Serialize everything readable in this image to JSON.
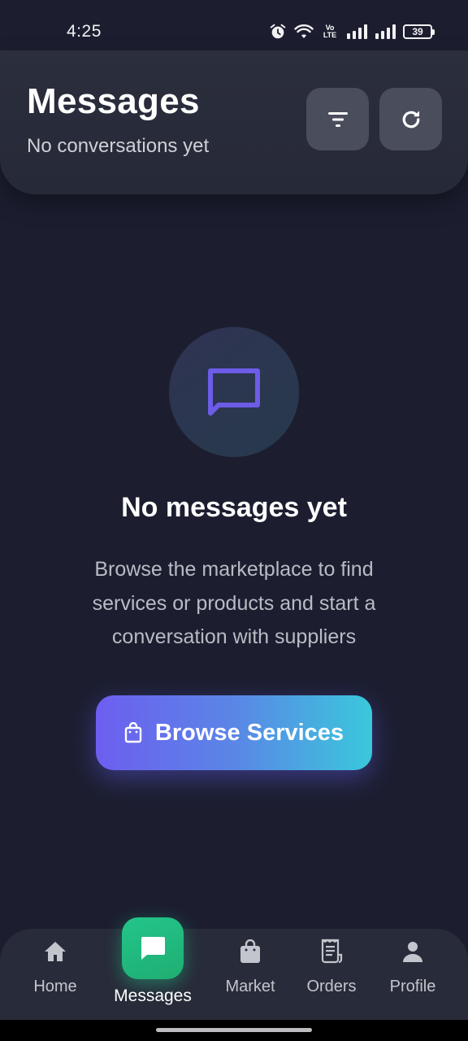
{
  "status_bar": {
    "time": "4:25",
    "volte_top": "Vo",
    "volte_bottom": "LTE",
    "battery_level": "39",
    "icons": [
      "alarm-icon",
      "wifi-icon",
      "volte-icon",
      "signal-icon",
      "signal-icon",
      "battery-icon"
    ]
  },
  "header": {
    "title": "Messages",
    "subtitle": "No conversations yet",
    "filter_icon": "filter-icon",
    "refresh_icon": "refresh-icon"
  },
  "empty_state": {
    "icon": "chat-bubble-icon",
    "title": "No messages yet",
    "description_lines": [
      "Browse the marketplace to find",
      "services or products and start a",
      "conversation with suppliers"
    ],
    "button_label": "Browse Services",
    "button_icon": "shopping-bag-icon"
  },
  "bottom_nav": {
    "items": [
      {
        "label": "Home",
        "icon": "home-icon"
      },
      {
        "label": "Messages",
        "icon": "chat-icon",
        "active": true
      },
      {
        "label": "Market",
        "icon": "shopping-bag-icon"
      },
      {
        "label": "Orders",
        "icon": "receipt-icon"
      },
      {
        "label": "Profile",
        "icon": "person-icon"
      }
    ]
  },
  "colors": {
    "background": "#1c1e30",
    "header_card": "#2b2e3c",
    "header_button": "#4a4d5b",
    "accent_purple": "#6d5ef0",
    "accent_cyan": "#3ac8dc",
    "nav_active": "#23c58a",
    "chat_icon_purple": "#6c5ce7"
  }
}
